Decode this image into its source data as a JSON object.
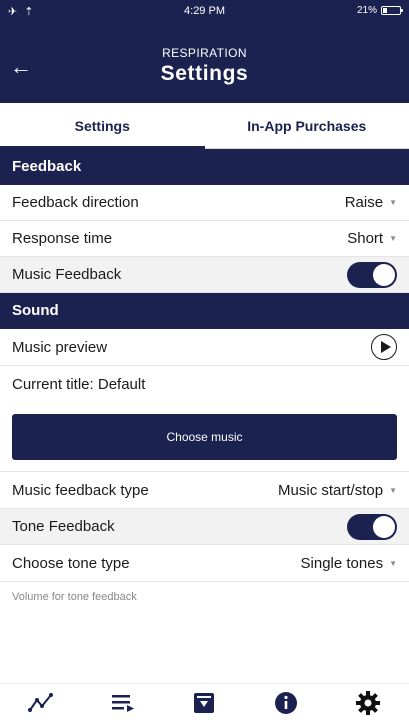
{
  "status": {
    "left": "✈ ⇡",
    "time": "4:29 PM",
    "battery": "21%"
  },
  "header": {
    "subtitle": "RESPIRATION",
    "title": "Settings",
    "back_icon": "arrow-left-icon"
  },
  "tabs": [
    {
      "label": "Settings",
      "active": true
    },
    {
      "label": "In-App Purchases",
      "active": false
    }
  ],
  "sections": {
    "feedback": "Feedback",
    "sound": "Sound"
  },
  "rows": {
    "feedback_direction": {
      "label": "Feedback direction",
      "value": "Raise"
    },
    "response_time": {
      "label": "Response time",
      "value": "Short"
    },
    "music_feedback": {
      "label": "Music Feedback",
      "enabled": true
    },
    "music_preview": {
      "label": "Music preview"
    },
    "current_title": {
      "label": "Current title: Default"
    },
    "choose_music": {
      "label": "Choose music"
    },
    "music_feedback_type": {
      "label": "Music feedback type",
      "value": "Music start/stop"
    },
    "tone_feedback": {
      "label": "Tone Feedback",
      "enabled": true
    },
    "tone_type": {
      "label": "Choose tone type",
      "value": "Single tones"
    },
    "volume": {
      "label": "Volume for tone feedback"
    }
  },
  "bottom_nav": [
    "graph-icon",
    "playlist-icon",
    "archive-icon",
    "info-icon",
    "gear-icon"
  ],
  "colors": {
    "primary": "#1c2250"
  }
}
